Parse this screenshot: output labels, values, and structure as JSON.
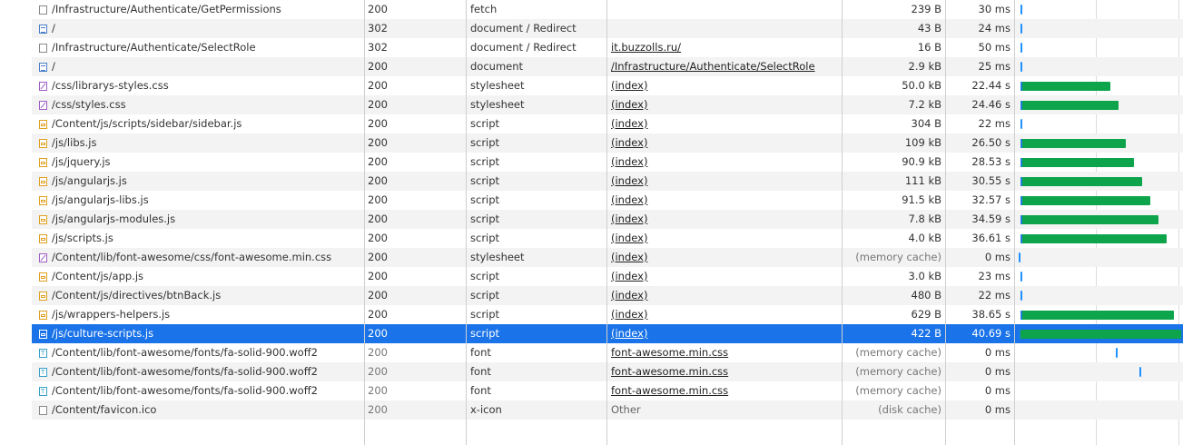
{
  "requests": [
    {
      "name": "/Infrastructure/Authenticate/GetPermissions",
      "status": "200",
      "type": "fetch",
      "initiator": "",
      "size": "239 B",
      "time": "30 ms",
      "icon": "fetch-icon"
    },
    {
      "name": "/",
      "status": "302",
      "type": "document / Redirect",
      "initiator": "",
      "size": "43 B",
      "time": "24 ms",
      "icon": "document-icon"
    },
    {
      "name": "/Infrastructure/Authenticate/SelectRole",
      "status": "302",
      "type": "document / Redirect",
      "initiator": "it.buzzolls.ru/",
      "size": "16 B",
      "time": "50 ms",
      "icon": "fetch-icon"
    },
    {
      "name": "/",
      "status": "200",
      "type": "document",
      "initiator": "/Infrastructure/Authenticate/SelectRole",
      "size": "2.9 kB",
      "time": "25 ms",
      "icon": "document-icon"
    },
    {
      "name": "/css/librarys-styles.css",
      "status": "200",
      "type": "stylesheet",
      "initiator": "(index)",
      "size": "50.0 kB",
      "time": "22.44 s",
      "icon": "stylesheet-icon"
    },
    {
      "name": "/css/styles.css",
      "status": "200",
      "type": "stylesheet",
      "initiator": "(index)",
      "size": "7.2 kB",
      "time": "24.46 s",
      "icon": "stylesheet-icon"
    },
    {
      "name": "/Content/js/scripts/sidebar/sidebar.js",
      "status": "200",
      "type": "script",
      "initiator": "(index)",
      "size": "304 B",
      "time": "22 ms",
      "icon": "script-icon"
    },
    {
      "name": "/js/libs.js",
      "status": "200",
      "type": "script",
      "initiator": "(index)",
      "size": "109 kB",
      "time": "26.50 s",
      "icon": "script-icon"
    },
    {
      "name": "/js/jquery.js",
      "status": "200",
      "type": "script",
      "initiator": "(index)",
      "size": "90.9 kB",
      "time": "28.53 s",
      "icon": "script-icon"
    },
    {
      "name": "/js/angularjs.js",
      "status": "200",
      "type": "script",
      "initiator": "(index)",
      "size": "111 kB",
      "time": "30.55 s",
      "icon": "script-icon"
    },
    {
      "name": "/js/angularjs-libs.js",
      "status": "200",
      "type": "script",
      "initiator": "(index)",
      "size": "91.5 kB",
      "time": "32.57 s",
      "icon": "script-icon"
    },
    {
      "name": "/js/angularjs-modules.js",
      "status": "200",
      "type": "script",
      "initiator": "(index)",
      "size": "7.8 kB",
      "time": "34.59 s",
      "icon": "script-icon"
    },
    {
      "name": "/js/scripts.js",
      "status": "200",
      "type": "script",
      "initiator": "(index)",
      "size": "4.0 kB",
      "time": "36.61 s",
      "icon": "script-icon"
    },
    {
      "name": "/Content/lib/font-awesome/css/font-awesome.min.css",
      "status": "200",
      "type": "stylesheet",
      "initiator": "(index)",
      "size": "(memory cache)",
      "time": "0 ms",
      "icon": "stylesheet-icon"
    },
    {
      "name": "/Content/js/app.js",
      "status": "200",
      "type": "script",
      "initiator": "(index)",
      "size": "3.0 kB",
      "time": "23 ms",
      "icon": "script-icon"
    },
    {
      "name": "/Content/js/directives/btnBack.js",
      "status": "200",
      "type": "script",
      "initiator": "(index)",
      "size": "480 B",
      "time": "22 ms",
      "icon": "script-icon"
    },
    {
      "name": "/js/wrappers-helpers.js",
      "status": "200",
      "type": "script",
      "initiator": "(index)",
      "size": "629 B",
      "time": "38.65 s",
      "icon": "script-icon"
    },
    {
      "name": "/js/culture-scripts.js",
      "status": "200",
      "type": "script",
      "initiator": "(index)",
      "size": "422 B",
      "time": "40.69 s",
      "icon": "script-icon",
      "selected": true
    },
    {
      "name": "/Content/lib/font-awesome/fonts/fa-solid-900.woff2",
      "status": "200",
      "type": "font",
      "initiator": "font-awesome.min.css",
      "size": "(memory cache)",
      "time": "0 ms",
      "icon": "font-icon"
    },
    {
      "name": "/Content/lib/font-awesome/fonts/fa-solid-900.woff2",
      "status": "200",
      "type": "font",
      "initiator": "font-awesome.min.css",
      "size": "(memory cache)",
      "time": "0 ms",
      "icon": "font-icon"
    },
    {
      "name": "/Content/lib/font-awesome/fonts/fa-solid-900.woff2",
      "status": "200",
      "type": "font",
      "initiator": "font-awesome.min.css",
      "size": "(memory cache)",
      "time": "0 ms",
      "icon": "font-icon"
    },
    {
      "name": "/Content/favicon.ico",
      "status": "200",
      "type": "x-icon",
      "initiator": "Other",
      "size": "(disk cache)",
      "time": "0 ms",
      "icon": "xicon-icon"
    }
  ],
  "colors": {
    "selected": "#1a73e8",
    "bar": "#0da44b",
    "tick": "#1e90ff"
  }
}
